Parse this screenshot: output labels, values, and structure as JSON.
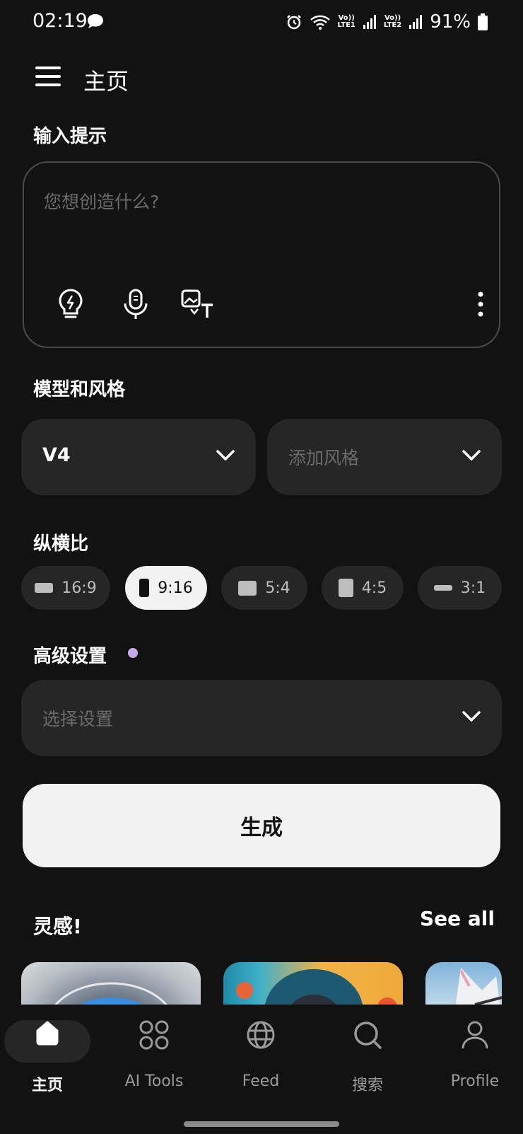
{
  "status_bar": {
    "time": "02:19",
    "battery": "91%",
    "sim1": "LTE1",
    "sim2": "LTE2",
    "volte": "Vo))"
  },
  "header": {
    "title": "主页"
  },
  "prompt": {
    "section_label": "输入提示",
    "placeholder": "您想创造什么?"
  },
  "model_style": {
    "section_label": "模型和风格",
    "model_value": "V4",
    "style_placeholder": "添加风格"
  },
  "aspect_ratio": {
    "section_label": "纵横比",
    "options": [
      "16:9",
      "9:16",
      "5:4",
      "4:5",
      "3:1"
    ],
    "selected": "9:16"
  },
  "advanced": {
    "section_label": "高级设置",
    "placeholder": "选择设置"
  },
  "generate_label": "生成",
  "inspiration": {
    "title": "灵感!",
    "see_all": "See all"
  },
  "nav": {
    "items": [
      "主页",
      "AI Tools",
      "Feed",
      "搜索",
      "Profile"
    ],
    "active": "主页"
  },
  "colors": {
    "background": "#121212",
    "card": "#262626",
    "accent_dot": "#c6a9e8",
    "button": "#f2f2f2"
  }
}
